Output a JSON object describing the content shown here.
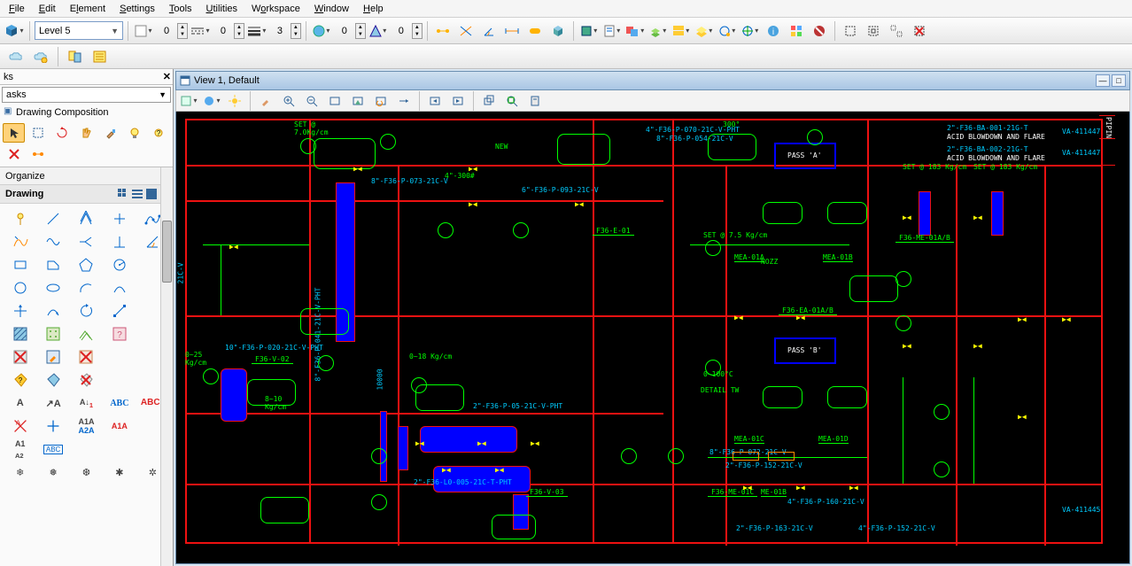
{
  "menu": {
    "file": "File",
    "edit": "Edit",
    "element": "Element",
    "settings": "Settings",
    "tools": "Tools",
    "utilities": "Utilities",
    "workspace": "Workspace",
    "window": "Window",
    "help": "Help"
  },
  "toolbar": {
    "level_combo": "Level 5",
    "color_spin": "0",
    "line_spin": "0",
    "weight_spin": "3",
    "global_spin": "0",
    "priority_spin": "0"
  },
  "leftpanel": {
    "title": "ks",
    "tasks_combo": "asks",
    "tree_item": "Drawing Composition",
    "cat_organize": "Organize",
    "cat_drawing": "Drawing"
  },
  "view": {
    "title": "View 1, Default"
  },
  "drawing": {
    "labels": {
      "set1": "SET @",
      "set1b": "7.0Kg/cm",
      "f36e01": "F36-E-01",
      "f36v02": "F36-V-02",
      "f36v03": "F36-V-03",
      "f36me01c": "F36-ME-01C",
      "f36me01ab": "F36-ME-01A/B",
      "f36ea01ab": "F36-EA-01A/B",
      "mea01a": "MEA-01A",
      "mea01b": "MEA-01B",
      "mea01c": "MEA-01C",
      "mea01d": "MEA-01D",
      "me01b": "ME-01B",
      "passa": "PASS 'A'",
      "passb": "PASS 'B'",
      "acid1": "ACID BLOWDOWN AND FLARE",
      "acid2": "ACID BLOWDOWN AND FLARE",
      "va1": "VA-411447",
      "va2": "VA-411447",
      "va3": "VA-411445",
      "set183a": "SET @ 183 Kg/cm",
      "set183b": "SET @ 183 Kg/cm",
      "set75": "SET @ 7.5 Kg/cm",
      "range025": "0~25",
      "range025b": "Kg/cm",
      "range018": "0~18 Kg/cm",
      "range0100": "0~100°C",
      "detailTW": "DETAIL TW",
      "pipe1": "2\"-F36-BA-001-21G-T",
      "pipe2": "2\"-F36-BA-002-21G-T",
      "pipe_e": "4\"-F36-P-070-21C-V-PHT",
      "pipe_e2": "8\"-F36-P-054-21C-V",
      "pipe_f": "8\"-F36-P-073-21C-V",
      "pipe_g": "6\"-F36-P-093-21C-V",
      "pipe_h": "10\"-F36-P-020-21C-V-PHT",
      "pipe_i": "2\"-F36-P-05-21C-V-PHT",
      "pipe_j": "8\"-F36-P-041-21C-V-PHT",
      "pipe_k": "2\"-F36-L0-005-21C-T-PHT",
      "pipe_l": "4\"-F36-P-160-21C-V",
      "pipe_m": "2\"-F36-P-152-21C-V",
      "pipe_n": "2\"-F36-P-163-21C-V",
      "pipe_o": "4\"-F36-P-152-21C-V",
      "pipe_p": "8\"-F36-P-072-21C-V",
      "note809": "8~10",
      "note810": "Kg/cm",
      "ang300": "300°",
      "ang300b": "4\"-300#",
      "num1000": "10000",
      "note_new": "NEW",
      "note21c": "21C-V",
      "nozz": "NOZZ",
      "piping": "PIPIN"
    }
  }
}
